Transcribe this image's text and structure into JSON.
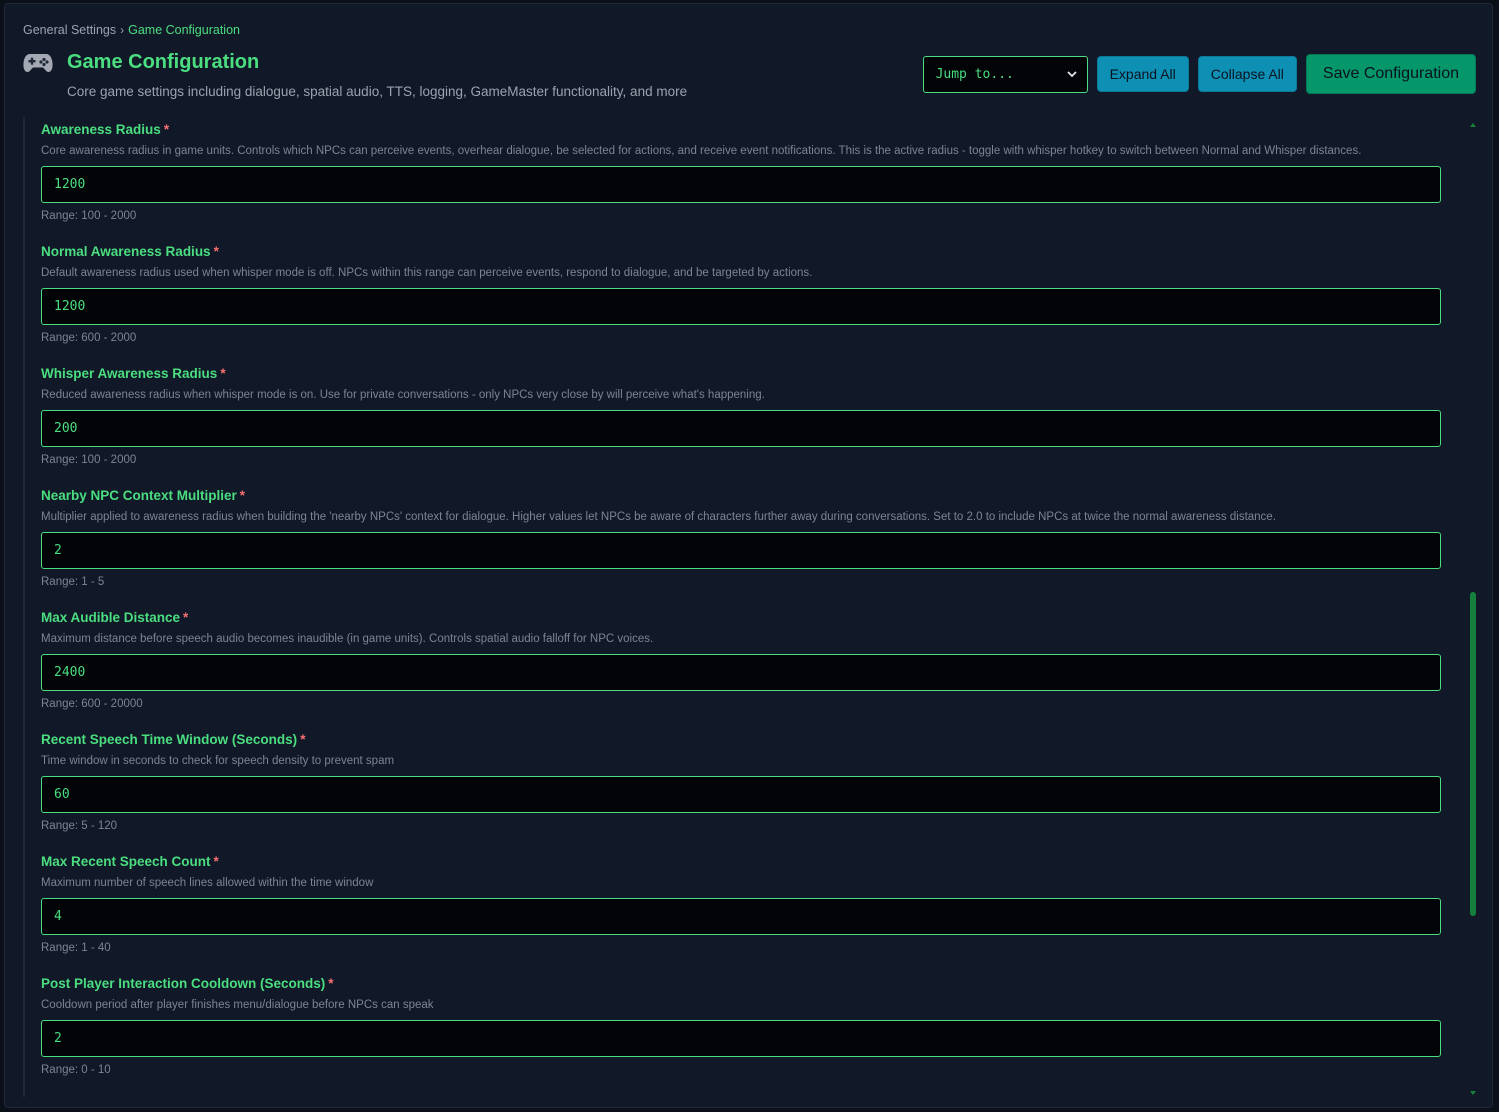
{
  "breadcrumb": {
    "root": "General Settings",
    "separator": "›",
    "current": "Game Configuration"
  },
  "header": {
    "icon": "gamepad-icon",
    "title": "Game Configuration",
    "subtitle": "Core game settings including dialogue, spatial audio, TTS, logging, GameMaster functionality, and more"
  },
  "toolbar": {
    "jump_to": "Jump to...",
    "expand_all": "Expand All",
    "collapse_all": "Collapse All",
    "save": "Save Configuration"
  },
  "required_marker": "*",
  "fields": [
    {
      "label": "Awareness Radius",
      "description": "Core awareness radius in game units. Controls which NPCs can perceive events, overhear dialogue, be selected for actions, and receive event notifications. This is the active radius - toggle with whisper hotkey to switch between Normal and Whisper distances.",
      "value": "1200",
      "range": "Range: 100 - 2000"
    },
    {
      "label": "Normal Awareness Radius",
      "description": "Default awareness radius used when whisper mode is off. NPCs within this range can perceive events, respond to dialogue, and be targeted by actions.",
      "value": "1200",
      "range": "Range: 600 - 2000"
    },
    {
      "label": "Whisper Awareness Radius",
      "description": "Reduced awareness radius when whisper mode is on. Use for private conversations - only NPCs very close by will perceive what's happening.",
      "value": "200",
      "range": "Range: 100 - 2000"
    },
    {
      "label": "Nearby NPC Context Multiplier",
      "description": "Multiplier applied to awareness radius when building the 'nearby NPCs' context for dialogue. Higher values let NPCs be aware of characters further away during conversations. Set to 2.0 to include NPCs at twice the normal awareness distance.",
      "value": "2",
      "range": "Range: 1 - 5"
    },
    {
      "label": "Max Audible Distance",
      "description": "Maximum distance before speech audio becomes inaudible (in game units). Controls spatial audio falloff for NPC voices.",
      "value": "2400",
      "range": "Range: 600 - 20000"
    },
    {
      "label": "Recent Speech Time Window (Seconds)",
      "description": "Time window in seconds to check for speech density to prevent spam",
      "value": "60",
      "range": "Range: 5 - 120"
    },
    {
      "label": "Max Recent Speech Count",
      "description": "Maximum number of speech lines allowed within the time window",
      "value": "4",
      "range": "Range: 1 - 40"
    },
    {
      "label": "Post Player Interaction Cooldown (Seconds)",
      "description": "Cooldown period after player finishes menu/dialogue before NPCs can speak",
      "value": "2",
      "range": "Range: 0 - 10"
    }
  ],
  "colors": {
    "accent": "#4ade80",
    "required": "#f87171",
    "button_blue": "#0e90b5",
    "button_save": "#059669",
    "background": "#111827"
  }
}
